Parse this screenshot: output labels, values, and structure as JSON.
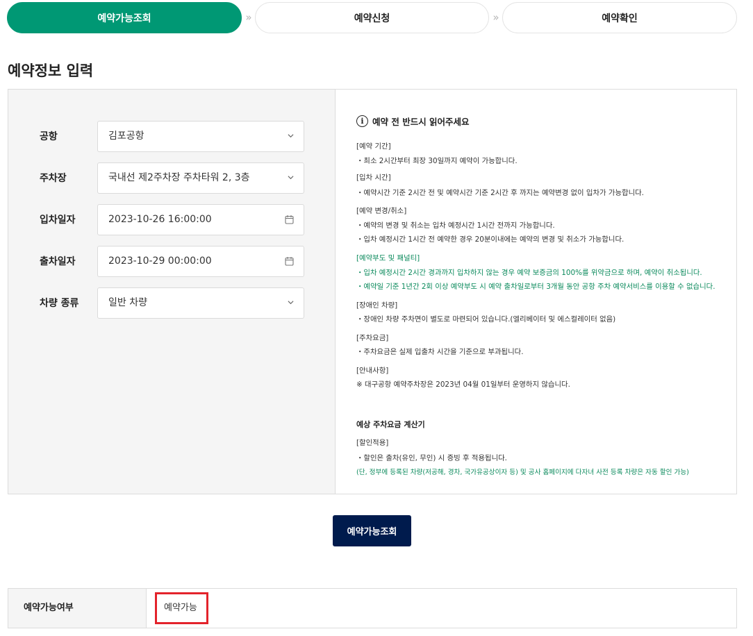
{
  "steps": [
    "예약가능조회",
    "예약신청",
    "예약확인"
  ],
  "section_title": "예약정보 입력",
  "form": {
    "airport_label": "공항",
    "airport_value": "김포공항",
    "parking_label": "주차장",
    "parking_value": "국내선 제2주차장 주차타워 2, 3층",
    "entry_label": "입차일자",
    "entry_value": "2023-10-26 16:00:00",
    "exit_label": "출차일자",
    "exit_value": "2023-10-29 00:00:00",
    "vehicle_label": "차량 종류",
    "vehicle_value": "일반 차량"
  },
  "notice": {
    "title": "예약 전 반드시 읽어주세요",
    "lines": [
      "[예약 기간]",
      "・최소 2시간부터 최장 30일까지 예약이 가능합니다.",
      "[입차 시간]",
      "・예약시간 기준 2시간 전 및 예약시간 기준 2시간 후 까지는 예약변경 없이 입차가 가능합니다.",
      "[예약 변경/취소]",
      "・예약의 변경 및 취소는 입차 예정시간 1시간 전까지 가능합니다.",
      "・입차 예정시간 1시간 전 예약한 경우 20분이내에는 예약의 변경 및 취소가 가능합니다.",
      "[예약부도 및 패널티]",
      "・입차 예정시간 2시간 경과까지 입차하지 않는 경우 예약 보증금의 100%를 위약금으로 하며, 예약이 취소됩니다.",
      "・예약일 기준 1년간 2회 이상 예약부도 시 예약 출차일로부터 3개월 동안 공항 주차 예약서비스를 이용할 수 없습니다.",
      "[장애인 차량]",
      "・장애인 차량 주차면이 별도로 마련되어 있습니다.(엘리베이터 및 에스컬레이터 없음)",
      "[주차요금]",
      "・주차요금은 실제 입출차 시간을 기준으로 부과됩니다.",
      "[안내사항]",
      "※ 대구공항 예약주차장은 2023년 04월 01일부터 운영하지 않습니다.",
      "예상 주차요금 계산기",
      "[할인적용]",
      "・할인은 출차(유인, 무인) 시 증빙 후 적용됩니다.",
      "(단, 정부에 등록된 차량(저공해, 경차, 국가유공상이자 등) 및 공사 홈페이지에 다자녀 사전 등록 차량은 자동 할인 가능)"
    ]
  },
  "search_button": "예약가능조회",
  "result": {
    "label": "예약가능여부",
    "value": "예약가능"
  },
  "colors": {
    "accent_green": "#009874",
    "navy_button": "#001b4d",
    "highlight_red": "#e3232b",
    "notice_green": "#0b8a5c"
  }
}
